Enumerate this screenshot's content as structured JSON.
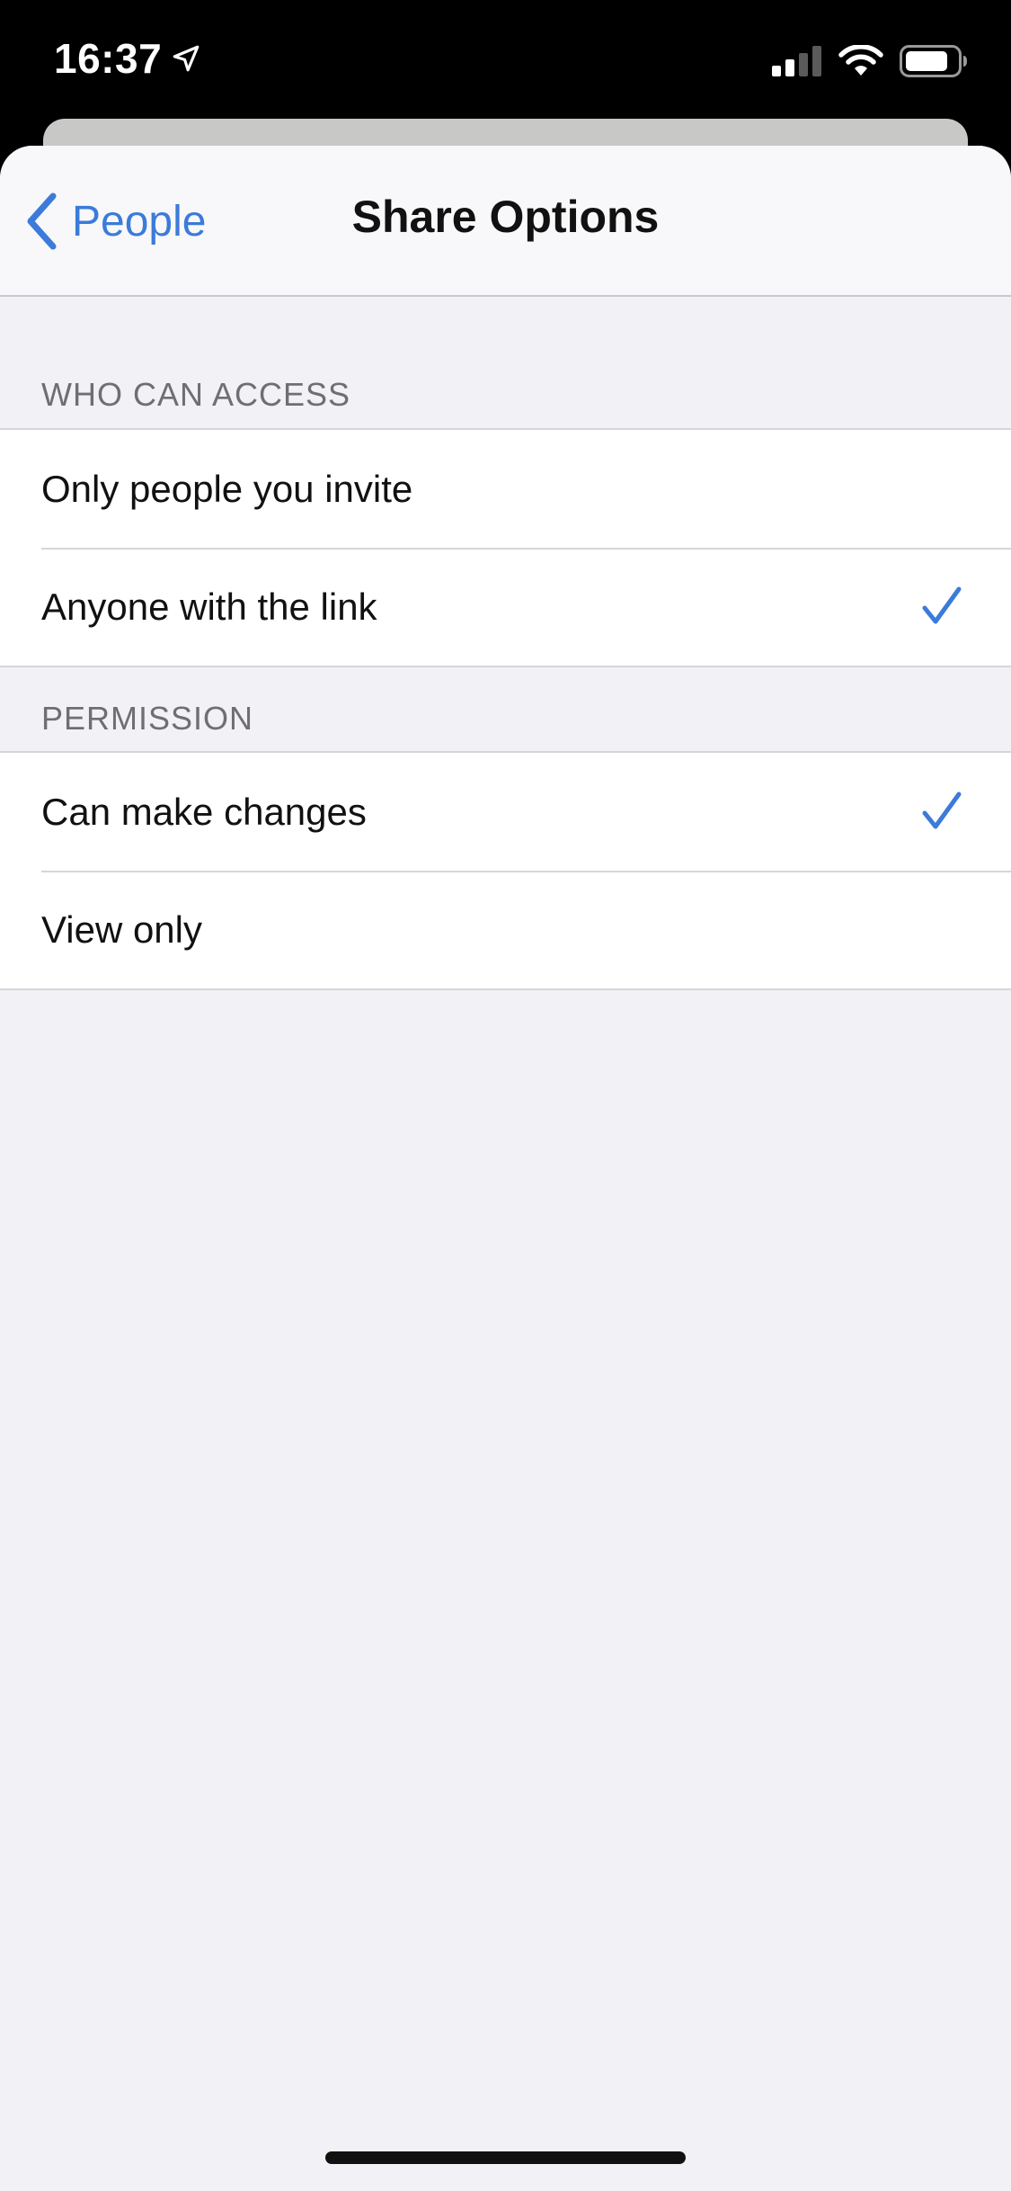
{
  "status_bar": {
    "time": "16:37",
    "location_icon": "location-arrow-icon",
    "signal_icon": "cellular-signal-icon",
    "wifi_icon": "wifi-icon",
    "battery_icon": "battery-icon"
  },
  "nav": {
    "back_label": "People",
    "back_icon": "chevron-left-icon",
    "title": "Share Options"
  },
  "sections": [
    {
      "header": "WHO CAN ACCESS",
      "rows": [
        {
          "label": "Only people you invite",
          "checked": false
        },
        {
          "label": "Anyone with the link",
          "checked": true
        }
      ]
    },
    {
      "header": "PERMISSION",
      "rows": [
        {
          "label": "Can make changes",
          "checked": true
        },
        {
          "label": "View only",
          "checked": false
        }
      ]
    }
  ],
  "colors": {
    "accent": "#3b7bd9",
    "background": "#f1f1f6",
    "cell": "#ffffff",
    "separator": "#d6d6da",
    "header_text": "#6e6e73"
  }
}
